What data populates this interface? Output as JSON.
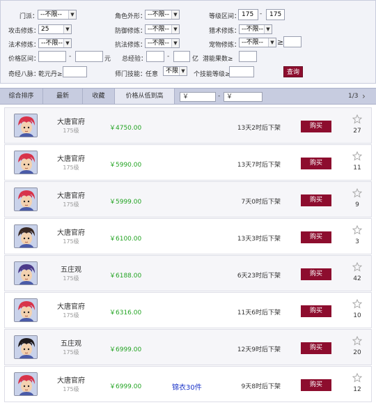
{
  "filters": {
    "school_label": "门派：",
    "school_value": "--不限--",
    "appearance_label": "角色外形：",
    "appearance_value": "--不限--",
    "level_label": "等级区间：",
    "level_min": "175",
    "level_sep": "-",
    "level_max": "175",
    "attack_label": "攻击修炼：",
    "attack_value": "25",
    "defense_label": "防御修炼：",
    "defense_value": "--不限--",
    "pet_label": "猎术修炼：",
    "pet_value": "--不限--",
    "magic_label": "法术修炼：",
    "magic_value": "--不限--",
    "resist_label": "抗法修炼：",
    "resist_value": "--不限--",
    "petskill_label": "宠物修炼：",
    "petskill_value": "--不限--",
    "petskill_gte": "≥",
    "price_label": "价格区间：",
    "price_sep": "-",
    "price_unit": "元",
    "exp_label": "总经验：",
    "exp_sep": "-",
    "exp_unit": "亿",
    "potential_label": "潜能果数≥",
    "meridian_label": "奇经八脉：",
    "qianyuan_label": "乾元丹≥",
    "skill_label": "师门技能：",
    "skill_any": "任意",
    "skill_value": "不限",
    "skill_level_label": "个技能等级≥",
    "query": "查询"
  },
  "tabs": [
    {
      "label": "综合排序"
    },
    {
      "label": "最新"
    },
    {
      "label": "收藏"
    },
    {
      "label": "价格从低到高"
    }
  ],
  "price_range": {
    "min_placeholder": "￥",
    "sep": "-",
    "max_placeholder": "￥"
  },
  "pager": {
    "text": "1/3",
    "next": "›"
  },
  "listings": [
    {
      "school": "大唐官府",
      "level": "175级",
      "price": "￥4750.00",
      "extra": "",
      "time": "13天2时后下架",
      "buy": "购买",
      "favs": "27",
      "avatar": "red"
    },
    {
      "school": "大唐官府",
      "level": "175级",
      "price": "￥5990.00",
      "extra": "",
      "time": "13天7时后下架",
      "buy": "购买",
      "favs": "11",
      "avatar": "red"
    },
    {
      "school": "大唐官府",
      "level": "175级",
      "price": "￥5999.00",
      "extra": "",
      "time": "7天0时后下架",
      "buy": "购买",
      "favs": "9",
      "avatar": "red"
    },
    {
      "school": "大唐官府",
      "level": "175级",
      "price": "￥6100.00",
      "extra": "",
      "time": "13天3时后下架",
      "buy": "购买",
      "favs": "3",
      "avatar": "dark"
    },
    {
      "school": "五庄观",
      "level": "175级",
      "price": "￥6188.00",
      "extra": "",
      "time": "6天23时后下架",
      "buy": "购买",
      "favs": "42",
      "avatar": "purple"
    },
    {
      "school": "大唐官府",
      "level": "175级",
      "price": "￥6316.00",
      "extra": "",
      "time": "11天6时后下架",
      "buy": "购买",
      "favs": "10",
      "avatar": "red"
    },
    {
      "school": "五庄观",
      "level": "175级",
      "price": "￥6999.00",
      "extra": "",
      "time": "12天9时后下架",
      "buy": "购买",
      "favs": "20",
      "avatar": "black"
    },
    {
      "school": "大唐官府",
      "level": "175级",
      "price": "￥6999.00",
      "extra": "锦衣30件",
      "time": "9天8时后下架",
      "buy": "购买",
      "favs": "12",
      "avatar": "red"
    }
  ],
  "colors": {
    "accent": "#8d0d2e",
    "price": "#22a322",
    "link": "#1a33c8",
    "avatar_red": "#d8334a",
    "avatar_dark": "#3a2a24",
    "avatar_purple": "#4b3a8a",
    "avatar_black": "#1e1a1c"
  },
  "icons": {
    "favorite": "star-outline-icon",
    "dropdown": "chevron-down-icon"
  }
}
